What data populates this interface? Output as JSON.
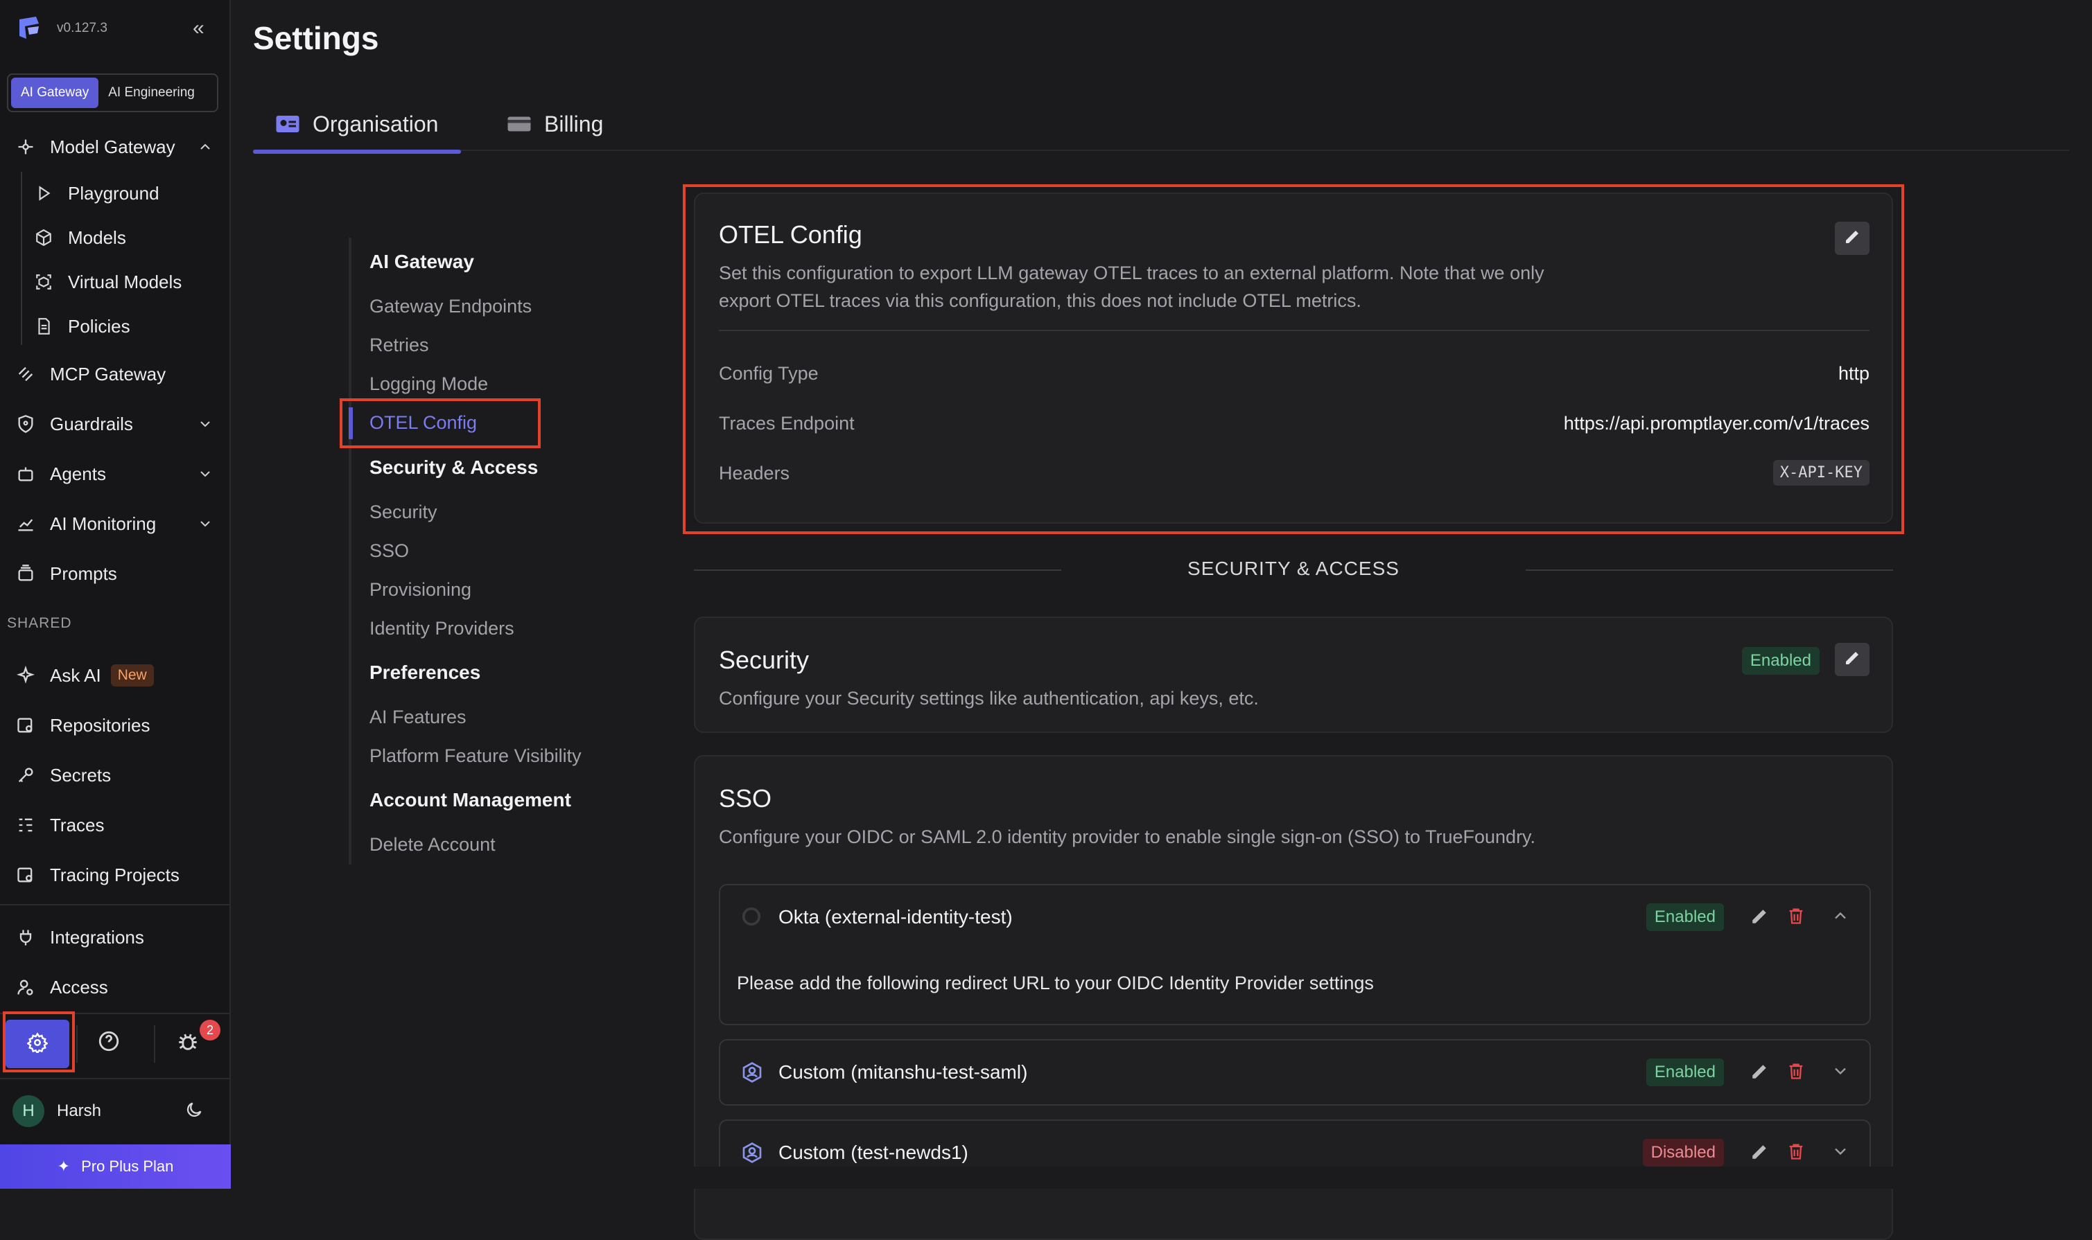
{
  "app": {
    "version": "v0.127.3",
    "mode_tabs": [
      "AI Gateway",
      "AI Engineering"
    ],
    "active_mode": "AI Gateway"
  },
  "sidebar": {
    "items": {
      "model_gateway": "Model Gateway",
      "playground": "Playground",
      "models": "Models",
      "virtual_models": "Virtual Models",
      "policies": "Policies",
      "mcp_gateway": "MCP Gateway",
      "guardrails": "Guardrails",
      "agents": "Agents",
      "ai_monitoring": "AI Monitoring",
      "prompts": "Prompts",
      "shared_label": "SHARED",
      "ask_ai": "Ask AI",
      "ask_ai_badge": "New",
      "repositories": "Repositories",
      "secrets": "Secrets",
      "traces": "Traces",
      "tracing_projects": "Tracing Projects",
      "integrations": "Integrations",
      "access": "Access"
    },
    "notification_count": "2",
    "user": {
      "initial": "H",
      "name": "Harsh"
    },
    "plan": "Pro Plus Plan"
  },
  "page": {
    "title": "Settings",
    "tabs": [
      "Organisation",
      "Billing"
    ],
    "active_tab": "Organisation"
  },
  "subnav": {
    "ai_gateway": "AI Gateway",
    "gateway_endpoints": "Gateway Endpoints",
    "retries": "Retries",
    "logging_mode": "Logging Mode",
    "otel_config": "OTEL Config",
    "security_access": "Security & Access",
    "security": "Security",
    "sso": "SSO",
    "provisioning": "Provisioning",
    "identity_providers": "Identity Providers",
    "preferences": "Preferences",
    "ai_features": "AI Features",
    "platform_feature_visibility": "Platform Feature Visibility",
    "account_management": "Account Management",
    "delete_account": "Delete Account"
  },
  "otel": {
    "title": "OTEL Config",
    "desc_line1": "Set this configuration to export LLM gateway OTEL traces to an external platform. Note that we only",
    "desc_line2": "export OTEL traces via this configuration, this does not include OTEL metrics.",
    "config_type_label": "Config Type",
    "config_type_value": "http",
    "endpoint_label": "Traces Endpoint",
    "endpoint_value": "https://api.promptlayer.com/v1/traces",
    "headers_label": "Headers",
    "headers_value": "X-API-KEY"
  },
  "section_divider": "SECURITY & ACCESS",
  "security_card": {
    "title": "Security",
    "status": "Enabled",
    "desc": "Configure your Security settings like authentication, api keys, etc."
  },
  "sso_card": {
    "title": "SSO",
    "desc": "Configure your OIDC or SAML 2.0 identity provider to enable single sign-on (SSO) to TrueFoundry.",
    "providers": [
      {
        "name": "Okta (external-identity-test)",
        "status": "Enabled",
        "note": "Please add the following redirect URL to your OIDC Identity Provider settings"
      },
      {
        "name": "Custom (mitanshu-test-saml)",
        "status": "Enabled"
      },
      {
        "name": "Custom (test-newds1)",
        "status": "Disabled"
      }
    ]
  },
  "colors": {
    "accent": "#5b5bd6",
    "highlight_outline": "#e2412c",
    "enabled": "#7bd4a1",
    "disabled": "#f08a92",
    "danger_icon": "#e5484d"
  }
}
